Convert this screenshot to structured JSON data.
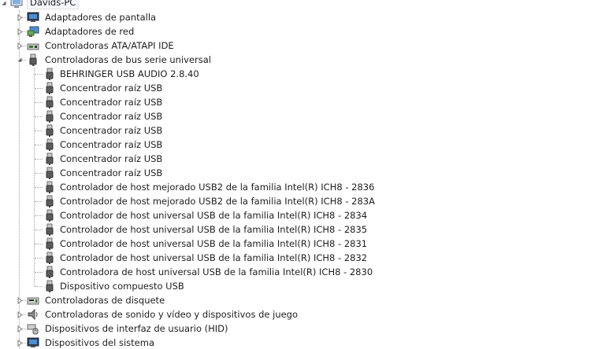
{
  "root": {
    "label": "Davids-PC",
    "icon": "computer-icon"
  },
  "categories_before": [
    {
      "label": "Adaptadores de pantalla",
      "icon": "display-adapter-icon",
      "expanded": false
    },
    {
      "label": "Adaptadores de red",
      "icon": "network-adapter-icon",
      "expanded": false
    },
    {
      "label": "Controladoras ATA/ATAPI IDE",
      "icon": "ide-controller-icon",
      "expanded": false
    },
    {
      "label": "Controladoras de bus serie universal",
      "icon": "usb-plug-icon",
      "expanded": true
    }
  ],
  "usb_children": [
    {
      "label": "BEHRINGER USB AUDIO 2.8.40"
    },
    {
      "label": "Concentrador raíz USB"
    },
    {
      "label": "Concentrador raíz USB"
    },
    {
      "label": "Concentrador raíz USB"
    },
    {
      "label": "Concentrador raíz USB"
    },
    {
      "label": "Concentrador raíz USB"
    },
    {
      "label": "Concentrador raíz USB"
    },
    {
      "label": "Concentrador raíz USB"
    },
    {
      "label": "Controlador de host mejorado USB2 de la familia Intel(R) ICH8 - 2836"
    },
    {
      "label": "Controlador de host mejorado USB2 de la familia Intel(R) ICH8 - 283A"
    },
    {
      "label": "Controlador de host universal USB de la familia Intel(R) ICH8 - 2834"
    },
    {
      "label": "Controlador de host universal USB de la familia Intel(R) ICH8 - 2835"
    },
    {
      "label": "Controlador de host universal USB de la familia Intel(R) ICH8 - 2831"
    },
    {
      "label": "Controlador de host universal USB de la familia Intel(R) ICH8 - 2832"
    },
    {
      "label": "Controladora de host universal USB de la familia Intel(R) ICH8 - 2830"
    },
    {
      "label": "Dispositivo compuesto USB"
    }
  ],
  "categories_after": [
    {
      "label": "Controladoras de disquete",
      "icon": "floppy-controller-icon",
      "expanded": false
    },
    {
      "label": "Controladoras de sonido y vídeo y dispositivos de juego",
      "icon": "speaker-icon",
      "expanded": false
    },
    {
      "label": "Dispositivos de interfaz de usuario (HID)",
      "icon": "hid-icon",
      "expanded": false
    },
    {
      "label": "Dispositivos del sistema",
      "icon": "system-device-icon",
      "expanded": false
    }
  ],
  "colors": {
    "text": "#1e1e1e",
    "tree_line": "#a0a0a0",
    "expander": "#5a5a5a",
    "selection_border": "#e2e2e2"
  }
}
